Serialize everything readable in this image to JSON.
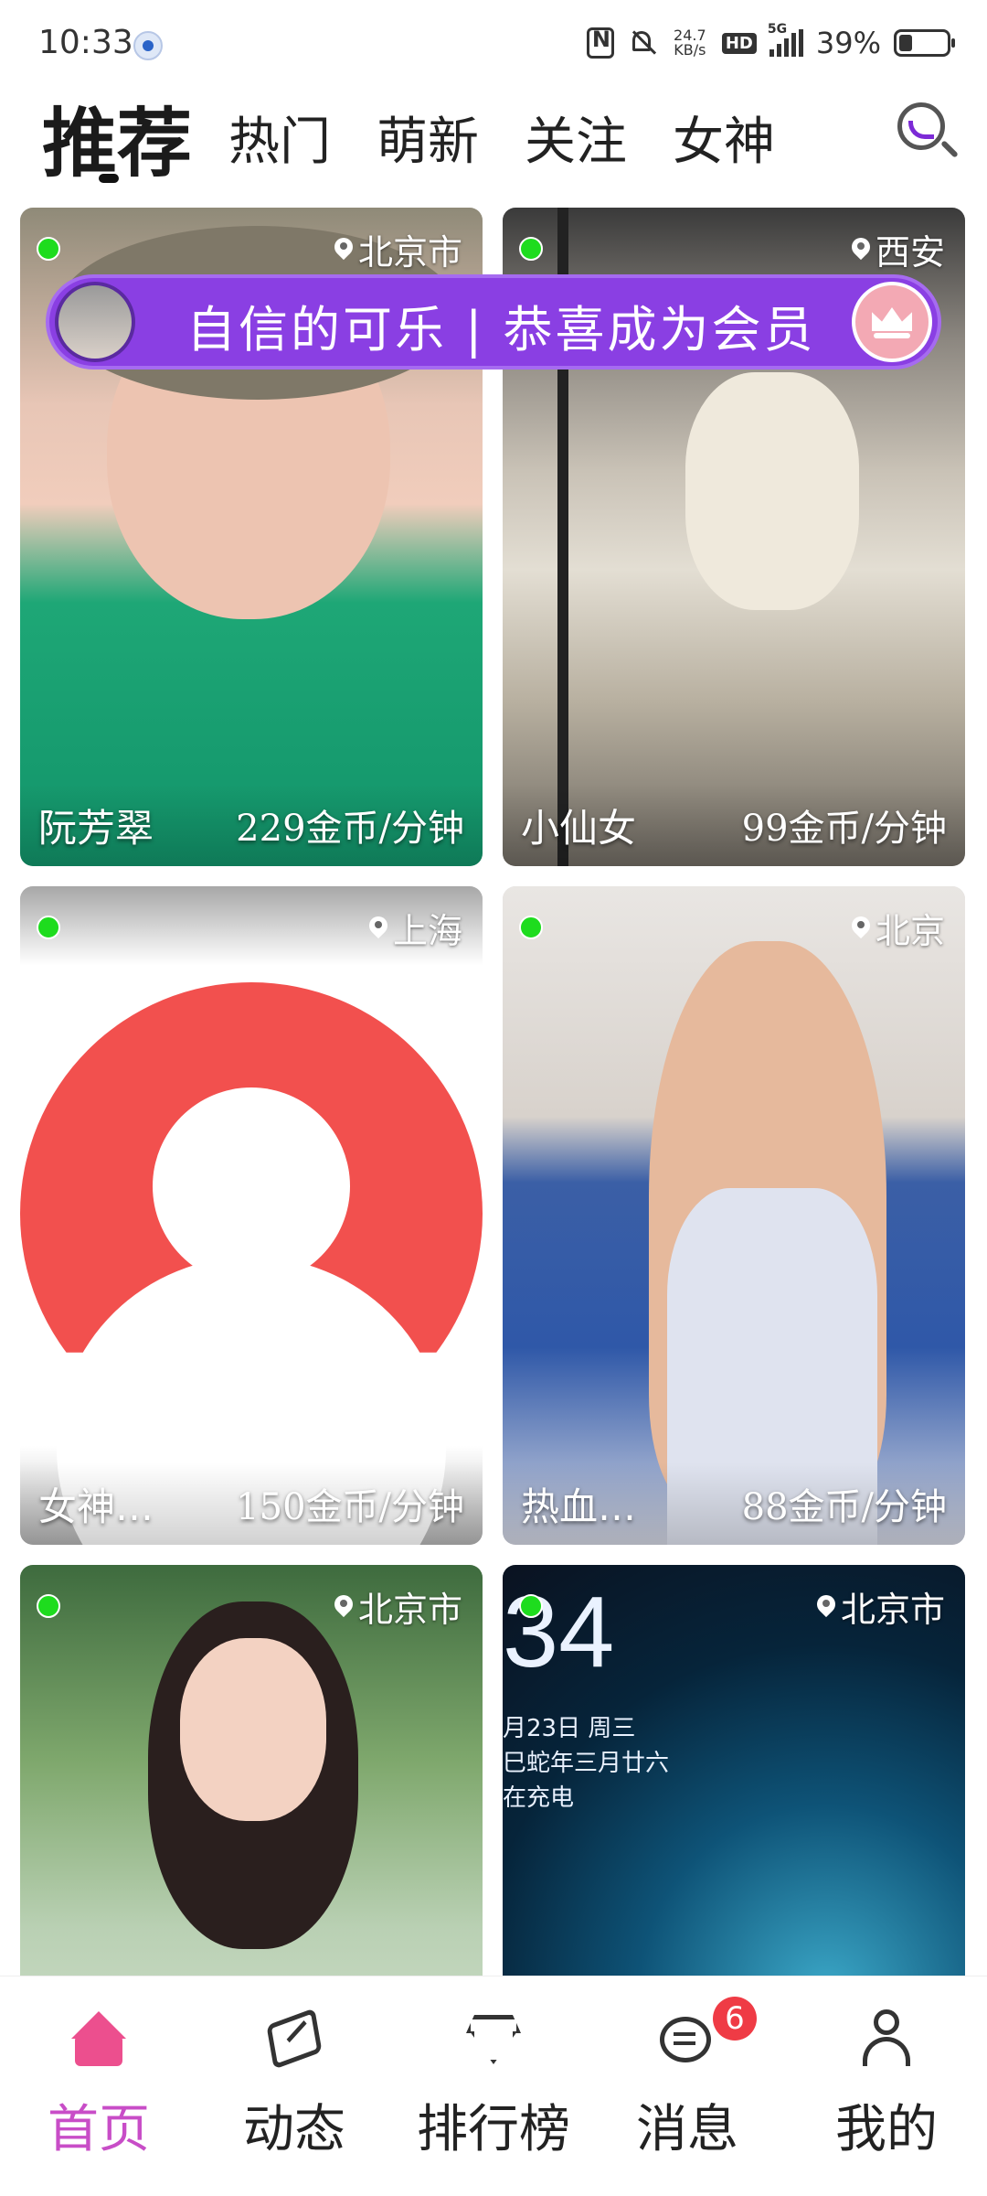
{
  "status_bar": {
    "time": "10:33",
    "net_speed_value": "24.7",
    "net_speed_unit": "KB/s",
    "hd_label": "HD",
    "signal_label": "5G",
    "battery_percent": "39%"
  },
  "top_tabs": [
    {
      "label": "推荐",
      "active": true
    },
    {
      "label": "热门",
      "active": false
    },
    {
      "label": "萌新",
      "active": false
    },
    {
      "label": "关注",
      "active": false
    },
    {
      "label": "女神",
      "active": false
    }
  ],
  "member_toast": {
    "text": "自信的可乐 | 恭喜成为会员"
  },
  "cards": [
    {
      "name": "阮芳翠",
      "price": "229金币/分钟",
      "location": "北京市",
      "online": true
    },
    {
      "name": "小仙女",
      "price": "99金币/分钟",
      "location": "西安",
      "online": true
    },
    {
      "name": "女神…",
      "price": "150金币/分钟",
      "location": "上海",
      "online": true
    },
    {
      "name": "热血…",
      "price": "88金币/分钟",
      "location": "北京",
      "online": true
    },
    {
      "name": "",
      "price": "",
      "location": "北京市",
      "online": true
    },
    {
      "name": "",
      "price": "",
      "location": "北京市",
      "online": true,
      "lock_clock": "34",
      "lock_date_line1": "月23日 周三",
      "lock_date_line2": "巳蛇年三月廿六",
      "lock_date_line3": "在充电"
    }
  ],
  "bottom_nav": [
    {
      "label": "首页",
      "icon": "home-icon",
      "active": true
    },
    {
      "label": "动态",
      "icon": "paper-plane-icon",
      "active": false
    },
    {
      "label": "排行榜",
      "icon": "diamond-icon",
      "active": false
    },
    {
      "label": "消息",
      "icon": "message-icon",
      "active": false,
      "badge": "6"
    },
    {
      "label": "我的",
      "icon": "user-icon",
      "active": false
    }
  ],
  "colors": {
    "accent_purple": "#8a3fe3",
    "active_nav": "#c84dc7",
    "online_green": "#1edc1e",
    "badge_red": "#ef3b45"
  }
}
